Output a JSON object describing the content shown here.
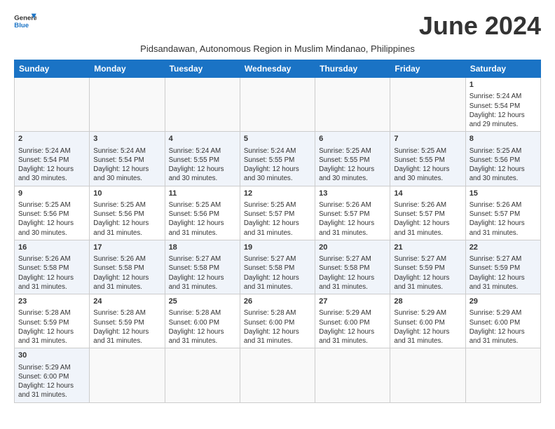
{
  "header": {
    "logo_general": "General",
    "logo_blue": "Blue",
    "month_title": "June 2024",
    "subtitle": "Pidsandawan, Autonomous Region in Muslim Mindanao, Philippines"
  },
  "columns": [
    "Sunday",
    "Monday",
    "Tuesday",
    "Wednesday",
    "Thursday",
    "Friday",
    "Saturday"
  ],
  "weeks": [
    {
      "days": [
        {
          "num": "",
          "info": ""
        },
        {
          "num": "",
          "info": ""
        },
        {
          "num": "",
          "info": ""
        },
        {
          "num": "",
          "info": ""
        },
        {
          "num": "",
          "info": ""
        },
        {
          "num": "",
          "info": ""
        },
        {
          "num": "1",
          "info": "Sunrise: 5:24 AM\nSunset: 5:54 PM\nDaylight: 12 hours\nand 29 minutes."
        }
      ]
    },
    {
      "days": [
        {
          "num": "2",
          "info": "Sunrise: 5:24 AM\nSunset: 5:54 PM\nDaylight: 12 hours\nand 30 minutes."
        },
        {
          "num": "3",
          "info": "Sunrise: 5:24 AM\nSunset: 5:54 PM\nDaylight: 12 hours\nand 30 minutes."
        },
        {
          "num": "4",
          "info": "Sunrise: 5:24 AM\nSunset: 5:55 PM\nDaylight: 12 hours\nand 30 minutes."
        },
        {
          "num": "5",
          "info": "Sunrise: 5:24 AM\nSunset: 5:55 PM\nDaylight: 12 hours\nand 30 minutes."
        },
        {
          "num": "6",
          "info": "Sunrise: 5:25 AM\nSunset: 5:55 PM\nDaylight: 12 hours\nand 30 minutes."
        },
        {
          "num": "7",
          "info": "Sunrise: 5:25 AM\nSunset: 5:55 PM\nDaylight: 12 hours\nand 30 minutes."
        },
        {
          "num": "8",
          "info": "Sunrise: 5:25 AM\nSunset: 5:56 PM\nDaylight: 12 hours\nand 30 minutes."
        }
      ]
    },
    {
      "days": [
        {
          "num": "9",
          "info": "Sunrise: 5:25 AM\nSunset: 5:56 PM\nDaylight: 12 hours\nand 30 minutes."
        },
        {
          "num": "10",
          "info": "Sunrise: 5:25 AM\nSunset: 5:56 PM\nDaylight: 12 hours\nand 31 minutes."
        },
        {
          "num": "11",
          "info": "Sunrise: 5:25 AM\nSunset: 5:56 PM\nDaylight: 12 hours\nand 31 minutes."
        },
        {
          "num": "12",
          "info": "Sunrise: 5:25 AM\nSunset: 5:57 PM\nDaylight: 12 hours\nand 31 minutes."
        },
        {
          "num": "13",
          "info": "Sunrise: 5:26 AM\nSunset: 5:57 PM\nDaylight: 12 hours\nand 31 minutes."
        },
        {
          "num": "14",
          "info": "Sunrise: 5:26 AM\nSunset: 5:57 PM\nDaylight: 12 hours\nand 31 minutes."
        },
        {
          "num": "15",
          "info": "Sunrise: 5:26 AM\nSunset: 5:57 PM\nDaylight: 12 hours\nand 31 minutes."
        }
      ]
    },
    {
      "days": [
        {
          "num": "16",
          "info": "Sunrise: 5:26 AM\nSunset: 5:58 PM\nDaylight: 12 hours\nand 31 minutes."
        },
        {
          "num": "17",
          "info": "Sunrise: 5:26 AM\nSunset: 5:58 PM\nDaylight: 12 hours\nand 31 minutes."
        },
        {
          "num": "18",
          "info": "Sunrise: 5:27 AM\nSunset: 5:58 PM\nDaylight: 12 hours\nand 31 minutes."
        },
        {
          "num": "19",
          "info": "Sunrise: 5:27 AM\nSunset: 5:58 PM\nDaylight: 12 hours\nand 31 minutes."
        },
        {
          "num": "20",
          "info": "Sunrise: 5:27 AM\nSunset: 5:58 PM\nDaylight: 12 hours\nand 31 minutes."
        },
        {
          "num": "21",
          "info": "Sunrise: 5:27 AM\nSunset: 5:59 PM\nDaylight: 12 hours\nand 31 minutes."
        },
        {
          "num": "22",
          "info": "Sunrise: 5:27 AM\nSunset: 5:59 PM\nDaylight: 12 hours\nand 31 minutes."
        }
      ]
    },
    {
      "days": [
        {
          "num": "23",
          "info": "Sunrise: 5:28 AM\nSunset: 5:59 PM\nDaylight: 12 hours\nand 31 minutes."
        },
        {
          "num": "24",
          "info": "Sunrise: 5:28 AM\nSunset: 5:59 PM\nDaylight: 12 hours\nand 31 minutes."
        },
        {
          "num": "25",
          "info": "Sunrise: 5:28 AM\nSunset: 6:00 PM\nDaylight: 12 hours\nand 31 minutes."
        },
        {
          "num": "26",
          "info": "Sunrise: 5:28 AM\nSunset: 6:00 PM\nDaylight: 12 hours\nand 31 minutes."
        },
        {
          "num": "27",
          "info": "Sunrise: 5:29 AM\nSunset: 6:00 PM\nDaylight: 12 hours\nand 31 minutes."
        },
        {
          "num": "28",
          "info": "Sunrise: 5:29 AM\nSunset: 6:00 PM\nDaylight: 12 hours\nand 31 minutes."
        },
        {
          "num": "29",
          "info": "Sunrise: 5:29 AM\nSunset: 6:00 PM\nDaylight: 12 hours\nand 31 minutes."
        }
      ]
    },
    {
      "days": [
        {
          "num": "30",
          "info": "Sunrise: 5:29 AM\nSunset: 6:00 PM\nDaylight: 12 hours\nand 31 minutes."
        },
        {
          "num": "",
          "info": ""
        },
        {
          "num": "",
          "info": ""
        },
        {
          "num": "",
          "info": ""
        },
        {
          "num": "",
          "info": ""
        },
        {
          "num": "",
          "info": ""
        },
        {
          "num": "",
          "info": ""
        }
      ]
    }
  ]
}
